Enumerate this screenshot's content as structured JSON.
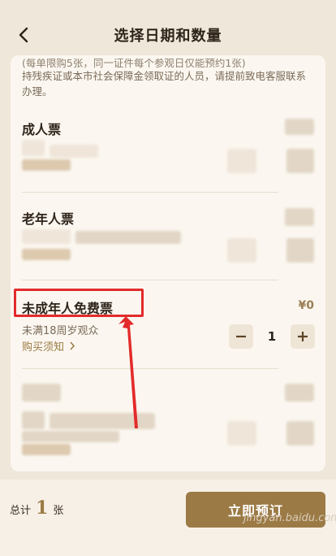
{
  "header": {
    "title": "选择日期和数量"
  },
  "notice": {
    "line1": "(每单限购5张，同一证件每个参观日仅能预约1张)",
    "line2": "持残疾证或本市社会保障金领取证的人员，请提前致电客服联系办理。"
  },
  "tickets": [
    {
      "title": "成人票"
    },
    {
      "title": "老年人票"
    },
    {
      "title": "未成年人免费票",
      "price": "¥0",
      "subtitle": "未满18周岁观众",
      "link": "购买须知",
      "quantity": "1"
    }
  ],
  "footer": {
    "total_prefix": "总计",
    "total_count": "1",
    "total_unit": "张",
    "book_label": "立即预订",
    "watermark": "jingyan.baidu.com"
  },
  "colors": {
    "accent": "#9c7a45",
    "highlight": "#e32b2b",
    "background": "#efe7d9"
  },
  "icons": {
    "back": "chevron-left-icon",
    "minus": "minus-icon",
    "plus": "plus-icon",
    "chevron": "chevron-right-icon",
    "arrow": "red-arrow-annotation"
  }
}
